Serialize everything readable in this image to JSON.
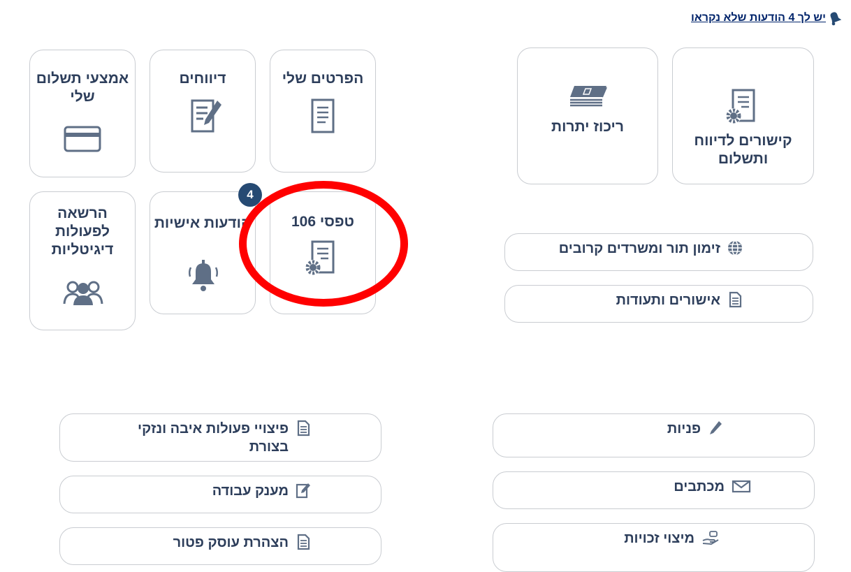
{
  "notice": {
    "text": "יש לך 4 הודעות שלא נקראו"
  },
  "tiles": {
    "payment_methods": "אמצעי תשלום שלי",
    "reports": "דיווחים",
    "my_details": "הפרטים שלי",
    "digital_authorization": "הרשאה לפעולות דיגיטליות",
    "personal_messages": "הודעות אישיות",
    "forms_106": "טפסי 106",
    "messages_badge": "4",
    "balance_summary": "ריכוז יתרות",
    "reporting_links": "קישורים לדיווח ותשלום"
  },
  "links": {
    "appointment": "זימון תור ומשרדים קרובים",
    "certificates": "אישורים ותעודות",
    "terror_compensation": "פיצויי פעולות איבה ונזקי בצורת",
    "inquiries": "פניות",
    "work_grant": "מענק עבודה",
    "letters": "מכתבים",
    "exempt_dealer": "הצהרת עוסק פטור",
    "rights": "מיצוי זכויות"
  },
  "colors": {
    "icon": "#5f6f86",
    "text": "#2d3e5b",
    "badge": "#264a73",
    "highlight": "#ff0000",
    "link": "#00246b"
  },
  "icons": {
    "notice": "bell-icon",
    "payment_methods": "credit-card-icon",
    "reports": "report-edit-icon",
    "my_details": "document-icon",
    "digital_authorization": "users-icon",
    "personal_messages": "bell-icon",
    "forms_106": "document-gear-icon",
    "balance_summary": "banknotes-icon",
    "reporting_links": "document-gear-icon",
    "appointment": "globe-icon",
    "certificates": "document-icon",
    "terror_compensation": "document-icon",
    "inquiries": "pencil-icon",
    "work_grant": "edit-document-icon",
    "letters": "envelope-icon",
    "exempt_dealer": "document-icon",
    "rights": "hand-coin-icon"
  }
}
